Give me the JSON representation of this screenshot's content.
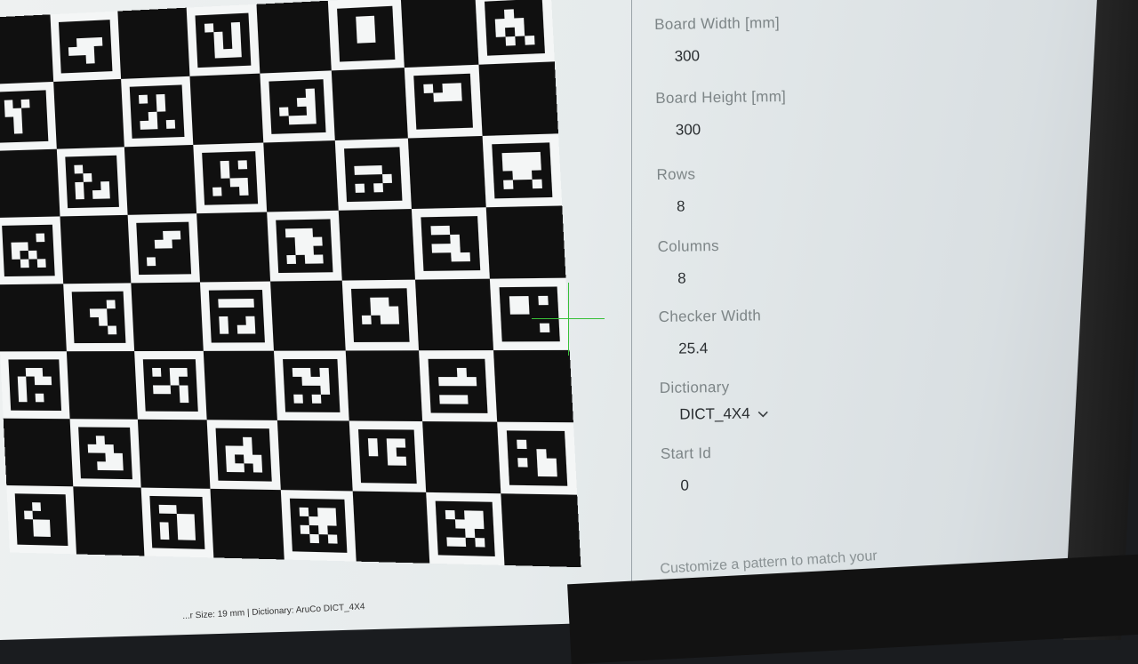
{
  "form": {
    "board_width_label": "Board Width [mm]",
    "board_width_value": "300",
    "board_height_label": "Board Height [mm]",
    "board_height_value": "300",
    "rows_label": "Rows",
    "rows_value": "8",
    "columns_label": "Columns",
    "columns_value": "8",
    "checker_width_label": "Checker Width",
    "checker_width_value": "25.4",
    "dictionary_label": "Dictionary",
    "dictionary_value": "DICT_4X4",
    "start_id_label": "Start Id",
    "start_id_value": "0"
  },
  "note": "Customize a pattern to match your",
  "caption": "...r Size: 19 mm | Dictionary: AruCo DICT_4X4",
  "board": {
    "rows": 8,
    "columns": 8,
    "markers": [
      [
        5,
        43,
        188,
        77
      ],
      [
        210,
        98,
        115,
        43
      ],
      [
        124,
        60,
        60,
        81
      ],
      [
        36,
        184,
        220,
        35
      ],
      [
        140,
        161,
        96,
        49
      ],
      [
        220,
        73,
        33,
        183
      ],
      [
        19,
        78,
        131,
        62
      ],
      [
        206,
        46,
        84,
        69
      ],
      [
        145,
        49,
        131,
        139
      ],
      [
        119,
        97,
        10,
        194
      ],
      [
        69,
        252,
        6,
        140
      ],
      [
        238,
        171,
        40,
        199
      ],
      [
        6,
        160,
        216,
        38
      ],
      [
        74,
        45,
        84,
        213
      ],
      [
        252,
        122,
        104,
        154
      ],
      [
        245,
        28,
        188,
        91
      ],
      [
        87,
        125,
        76,
        70
      ],
      [
        170,
        5,
        198,
        159
      ],
      [
        120,
        47,
        222,
        21
      ],
      [
        183,
        161,
        80,
        6
      ],
      [
        57,
        138,
        129,
        216
      ],
      [
        142,
        77,
        230,
        66
      ],
      [
        179,
        107,
        22,
        204
      ],
      [
        12,
        251,
        84,
        185
      ],
      [
        97,
        188,
        79,
        63
      ],
      [
        8,
        173,
        143,
        226
      ],
      [
        218,
        140,
        74,
        65
      ],
      [
        148,
        72,
        223,
        10
      ],
      [
        36,
        209,
        57,
        121
      ],
      [
        164,
        27,
        203,
        139
      ],
      [
        219,
        59,
        141,
        102
      ],
      [
        138,
        59,
        77,
        178
      ]
    ]
  },
  "colors": {
    "crosshair": "#39c039",
    "marker_black": "#101010",
    "label_gray": "#7d8587"
  }
}
